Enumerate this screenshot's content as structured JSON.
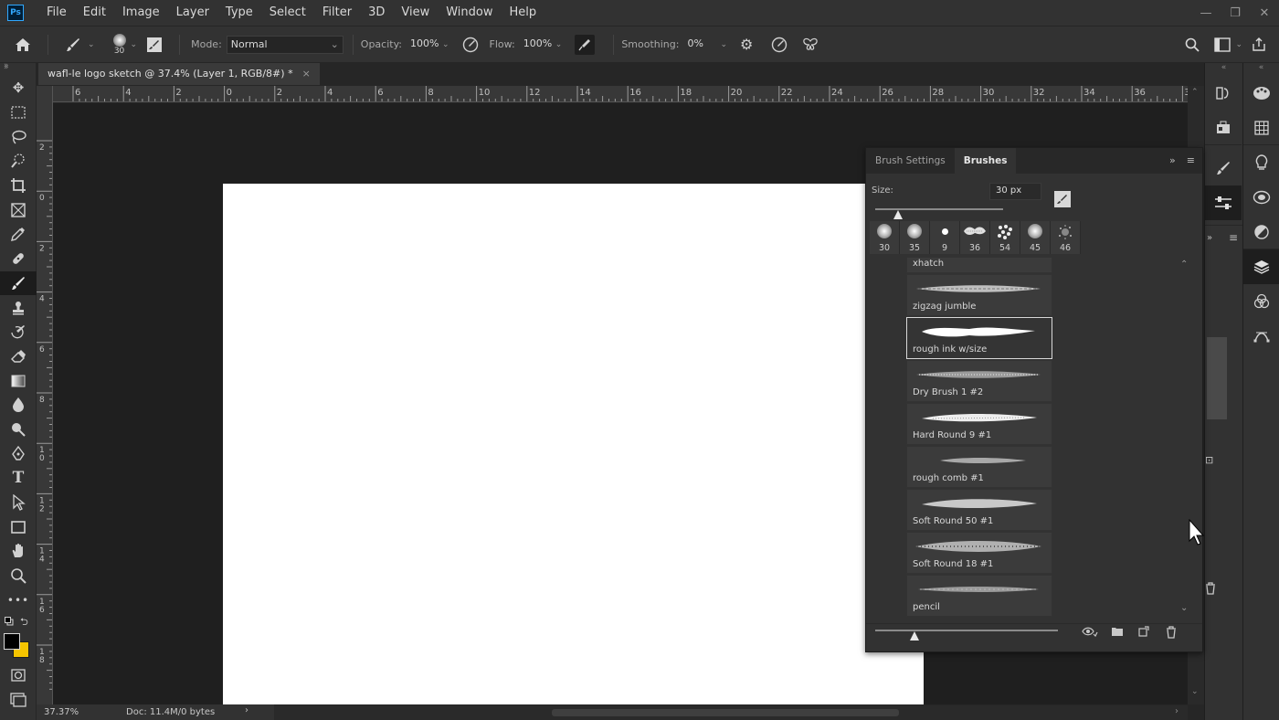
{
  "app": {
    "logo": "Ps"
  },
  "menu": [
    "File",
    "Edit",
    "Image",
    "Layer",
    "Type",
    "Select",
    "Filter",
    "3D",
    "View",
    "Window",
    "Help"
  ],
  "window_controls": [
    "—",
    "❐",
    "✕"
  ],
  "options": {
    "brush_size": "30",
    "mode_label": "Mode:",
    "mode_value": "Normal",
    "opacity_label": "Opacity:",
    "opacity_value": "100%",
    "flow_label": "Flow:",
    "flow_value": "100%",
    "smoothing_label": "Smoothing:",
    "smoothing_value": "0%"
  },
  "document": {
    "tab_title": "wafl-le logo sketch @ 37.4% (Layer 1, RGB/8#) *",
    "tab_close": "×"
  },
  "ruler_h": [
    "6",
    "4",
    "2",
    "0",
    "2",
    "4",
    "6",
    "8",
    "10",
    "12",
    "14",
    "16",
    "18",
    "20",
    "22",
    "24",
    "26",
    "28",
    "30",
    "32",
    "34",
    "36",
    "3"
  ],
  "ruler_v": [
    "2",
    "0",
    "2",
    "4",
    "6",
    "8",
    "10",
    "12",
    "14",
    "16",
    "18"
  ],
  "status": {
    "zoom": "37.37%",
    "doc_info": "Doc: 11.4M/0 bytes"
  },
  "panel": {
    "tabs": [
      "Brush Settings",
      "Brushes"
    ],
    "active_tab": "Brushes",
    "size_label": "Size:",
    "size_value": "30 px",
    "size_fraction": 0.18,
    "presets": [
      {
        "num": "30",
        "kind": "soft"
      },
      {
        "num": "35",
        "kind": "soft"
      },
      {
        "num": "9",
        "kind": "hard"
      },
      {
        "num": "36",
        "kind": "texture"
      },
      {
        "num": "54",
        "kind": "dots"
      },
      {
        "num": "45",
        "kind": "soft"
      },
      {
        "num": "46",
        "kind": "spatter"
      }
    ],
    "brushes": [
      {
        "name": "xhatch",
        "selected": false
      },
      {
        "name": "zigzag jumble",
        "selected": false
      },
      {
        "name": "rough ink w/size",
        "selected": true
      },
      {
        "name": "Dry Brush 1 #2",
        "selected": false
      },
      {
        "name": "Hard Round 9 #1",
        "selected": false
      },
      {
        "name": "rough comb #1",
        "selected": false
      },
      {
        "name": "Soft Round 50 #1",
        "selected": false
      },
      {
        "name": "Soft Round 18 #1",
        "selected": false
      },
      {
        "name": "pencil",
        "selected": false
      }
    ]
  },
  "colors": {
    "foreground": "#000000",
    "background": "#f5c400",
    "accent": "#31a8ff"
  }
}
